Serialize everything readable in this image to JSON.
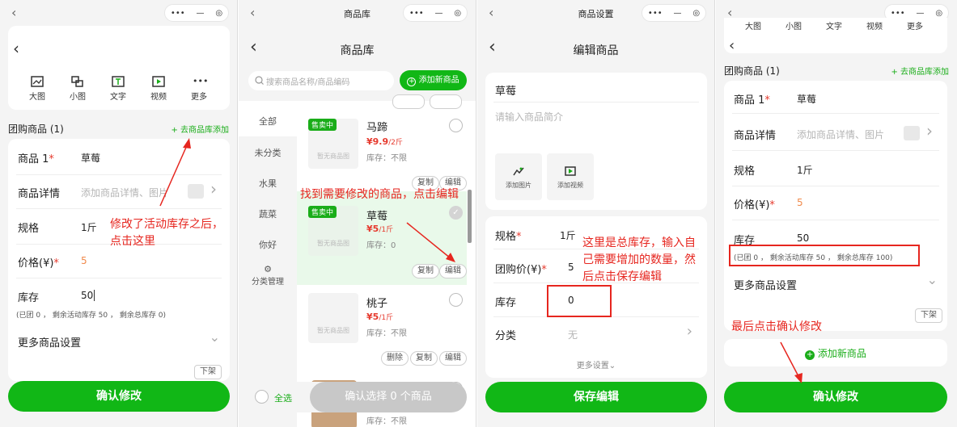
{
  "capsule": {
    "dots": "•••",
    "dash": "—",
    "target": "◎"
  },
  "icons": {
    "back": "‹",
    "chevron_right": "›",
    "chevron_down": "⌄",
    "plus": "+",
    "search": "○"
  },
  "colors": {
    "green": "#11b716",
    "red": "#e63a2e",
    "orange": "#f08a4b",
    "annotation": "#e6261f"
  },
  "p1": {
    "tools": [
      "大图",
      "小图",
      "文字",
      "视频",
      "更多"
    ],
    "group_title": "团购商品 (1)",
    "add_from_lib": "+ 去商品库添加",
    "rows": {
      "product_label": "商品 1",
      "product_value": "草莓",
      "detail_label": "商品详情",
      "detail_placeholder": "添加商品详情、图片",
      "spec_label": "规格",
      "spec_value": "1斤",
      "price_label": "价格(¥)",
      "price_value": "5",
      "stock_label": "库存",
      "stock_value": "50",
      "stock_note": "(已团 0 ， 剩余活动库存 50 ， 剩余总库存 0)",
      "more_settings": "更多商品设置",
      "offshelf": "下架"
    },
    "confirm": "确认修改",
    "annotation": [
      "修改了活动库存之后，",
      "点击这里"
    ]
  },
  "p2": {
    "title": "商品库",
    "page_title": "商品库",
    "search_placeholder": "搜索商品名称/商品编码",
    "add_new": "添加新商品",
    "categories": [
      "全部",
      "未分类",
      "水果",
      "蔬菜",
      "你好"
    ],
    "category_manage": "分类管理",
    "tag_on_sale": "售卖中",
    "no_image": "暂无商品图",
    "copy": "复制",
    "edit": "编辑",
    "delete": "删除",
    "goods": [
      {
        "name": "马蹄",
        "price": "¥9.9",
        "unit": "/2斤",
        "stock": "库存：不限"
      },
      {
        "name": "草莓",
        "price": "¥5",
        "unit": "/1斤",
        "stock": "库存：0"
      },
      {
        "name": "桃子",
        "price": "¥5",
        "unit": "/1斤",
        "stock": "库存：不限"
      }
    ],
    "last_stock": "库存：不限",
    "select_all": "全选",
    "confirm_select": "确认选择 0 个商品",
    "annotation": "找到需要修改的商品，点击编辑"
  },
  "p3": {
    "title": "商品设置",
    "page_title": "编辑商品",
    "name": "草莓",
    "intro_placeholder": "请输入商品简介",
    "add_image": "添加图片",
    "add_video": "添加视频",
    "spec_label": "规格",
    "spec_value": "1斤",
    "price_label": "团购价(¥)",
    "price_value": "5",
    "stock_label": "库存",
    "stock_value": "0",
    "category_label": "分类",
    "category_value": "无",
    "more": "更多设置",
    "save": "保存编辑",
    "annotation": [
      "这里是总库存，输入自",
      "己需要增加的数量，然",
      "后点击保存编辑"
    ]
  },
  "p4": {
    "tools": [
      "大图",
      "小图",
      "文字",
      "视频",
      "更多"
    ],
    "group_title": "团购商品 (1)",
    "add_from_lib": "+ 去商品库添加",
    "product_label": "商品 1",
    "product_value": "草莓",
    "detail_label": "商品详情",
    "detail_placeholder": "添加商品详情、图片",
    "spec_label": "规格",
    "spec_value": "1斤",
    "price_label": "价格(¥)",
    "price_value": "5",
    "stock_label": "库存",
    "stock_value": "50",
    "stock_note": "(已团 0 ， 剩余活动库存 50 ， 剩余总库存 100)",
    "more_settings": "更多商品设置",
    "offshelf": "下架",
    "add_new": "添加新商品",
    "confirm": "确认修改",
    "annotation": "最后点击确认修改"
  }
}
